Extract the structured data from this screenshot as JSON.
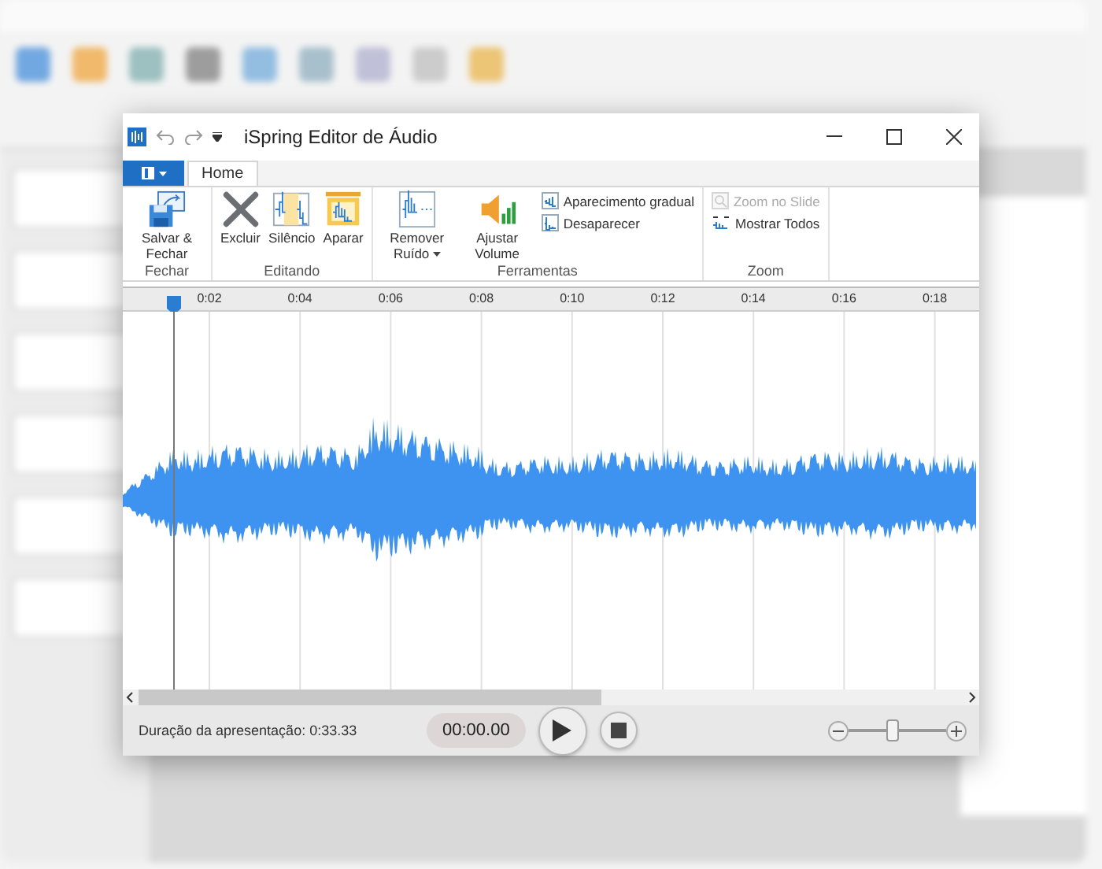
{
  "window": {
    "title": "iSpring Editor de Áudio"
  },
  "tabs": [
    {
      "label": "Home",
      "selected": true
    }
  ],
  "ribbon": {
    "groups": [
      {
        "label": "Fechar",
        "items": [
          {
            "kind": "large",
            "label": "Salvar & Fechar",
            "disabled": false
          }
        ]
      },
      {
        "label": "Editando",
        "items": [
          {
            "kind": "large",
            "label": "Excluir",
            "disabled": false
          },
          {
            "kind": "large",
            "label": "Silêncio",
            "disabled": false
          },
          {
            "kind": "large",
            "label": "Aparar",
            "disabled": false
          }
        ]
      },
      {
        "label": "Ferramentas",
        "items": [
          {
            "kind": "large",
            "label": "Remover Ruído",
            "dropdown": true,
            "disabled": false
          },
          {
            "kind": "large",
            "label": "Ajustar Volume",
            "disabled": false
          },
          {
            "kind": "small",
            "label": "Aparecimento gradual",
            "disabled": false
          },
          {
            "kind": "small",
            "label": "Desaparecer",
            "disabled": false
          }
        ]
      },
      {
        "label": "Zoom",
        "items": [
          {
            "kind": "small",
            "label": "Zoom no Slide",
            "disabled": true
          },
          {
            "kind": "small",
            "label": "Mostrar Todos",
            "disabled": false
          }
        ]
      }
    ]
  },
  "ruler": {
    "labels": [
      "0:02",
      "0:04",
      "0:06",
      "0:08",
      "0:10",
      "0:12",
      "0:14",
      "0:16",
      "0:18"
    ]
  },
  "footer": {
    "duration": "Duração da apresentação: 0:33.33",
    "time": "00:00.00",
    "zoom_slider": {
      "level": 0.45
    }
  }
}
